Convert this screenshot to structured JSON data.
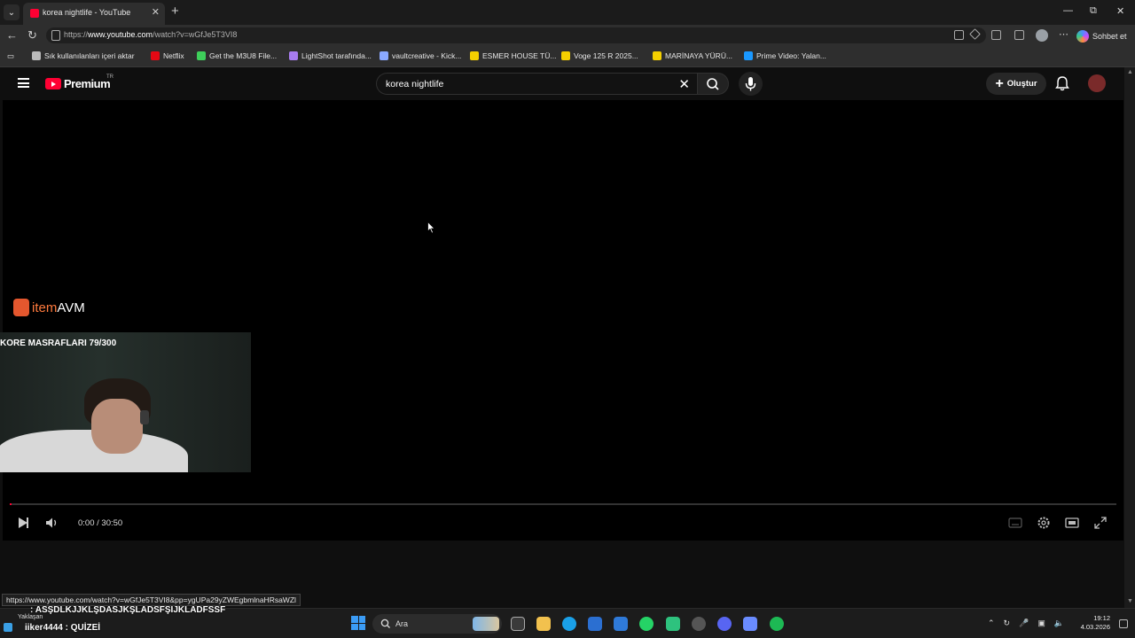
{
  "browser": {
    "tab_title": "korea nightlife - YouTube",
    "url_prefix": "https://",
    "url_host": "www.youtube.com",
    "url_path": "/watch?v=wGfJe5T3VI8",
    "copilot_label": "Sohbet et",
    "bookmarks": [
      {
        "label": "Sık kullanılanları içeri aktar",
        "icon": "import-icon",
        "color": "#bbbbbb"
      },
      {
        "label": "Netflix",
        "icon": "netflix-icon",
        "color": "#e50914"
      },
      {
        "label": "Get the M3U8 File...",
        "icon": "m3u8-icon",
        "color": "#3ecf5a"
      },
      {
        "label": "LightShot tarafında...",
        "icon": "lightshot-icon",
        "color": "#a87cf0"
      },
      {
        "label": "vaultcreative - Kick...",
        "icon": "vault-icon",
        "color": "#8aa8ff"
      },
      {
        "label": "ESMER HOUSE TÜ...",
        "icon": "s-icon",
        "color": "#f5d000"
      },
      {
        "label": "Voge 125 R 2025...",
        "icon": "s-icon",
        "color": "#f5d000"
      },
      {
        "label": "MARİNAYA YÜRÜ...",
        "icon": "s-icon",
        "color": "#f5d000"
      },
      {
        "label": "Prime Video: Yalan...",
        "icon": "prime-video-icon",
        "color": "#1a98ff"
      }
    ]
  },
  "youtube": {
    "logo_text": "Premium",
    "region": "TR",
    "search_value": "korea nightlife",
    "create_label": "Oluştur"
  },
  "player": {
    "sponsor_prefix": "item",
    "sponsor_suffix": "AVM",
    "overlay_caption": "KORE MASRAFLARI 79/300",
    "time": "0:00 / 30:50",
    "progress_fraction": 0.0
  },
  "status_url": "https://www.youtube.com/watch?v=wGfJe5T3VI8&pp=ygUPa29yZWEgbmlnaHRsaWZl",
  "stream_chat": {
    "line1": ": ASŞDLKJJKLŞDASJKŞLADSFŞIJKLADFSSF",
    "badge": "Yaklaşan",
    "line2": "iiker4444 : QUİZEİ"
  },
  "taskbar": {
    "search_label": "Ara",
    "time": "19:12",
    "date": "4.03.2026"
  },
  "colors": {
    "yt_red": "#ff0033",
    "background": "#0f0f0f",
    "accent_blue": "#3b9cf5"
  }
}
